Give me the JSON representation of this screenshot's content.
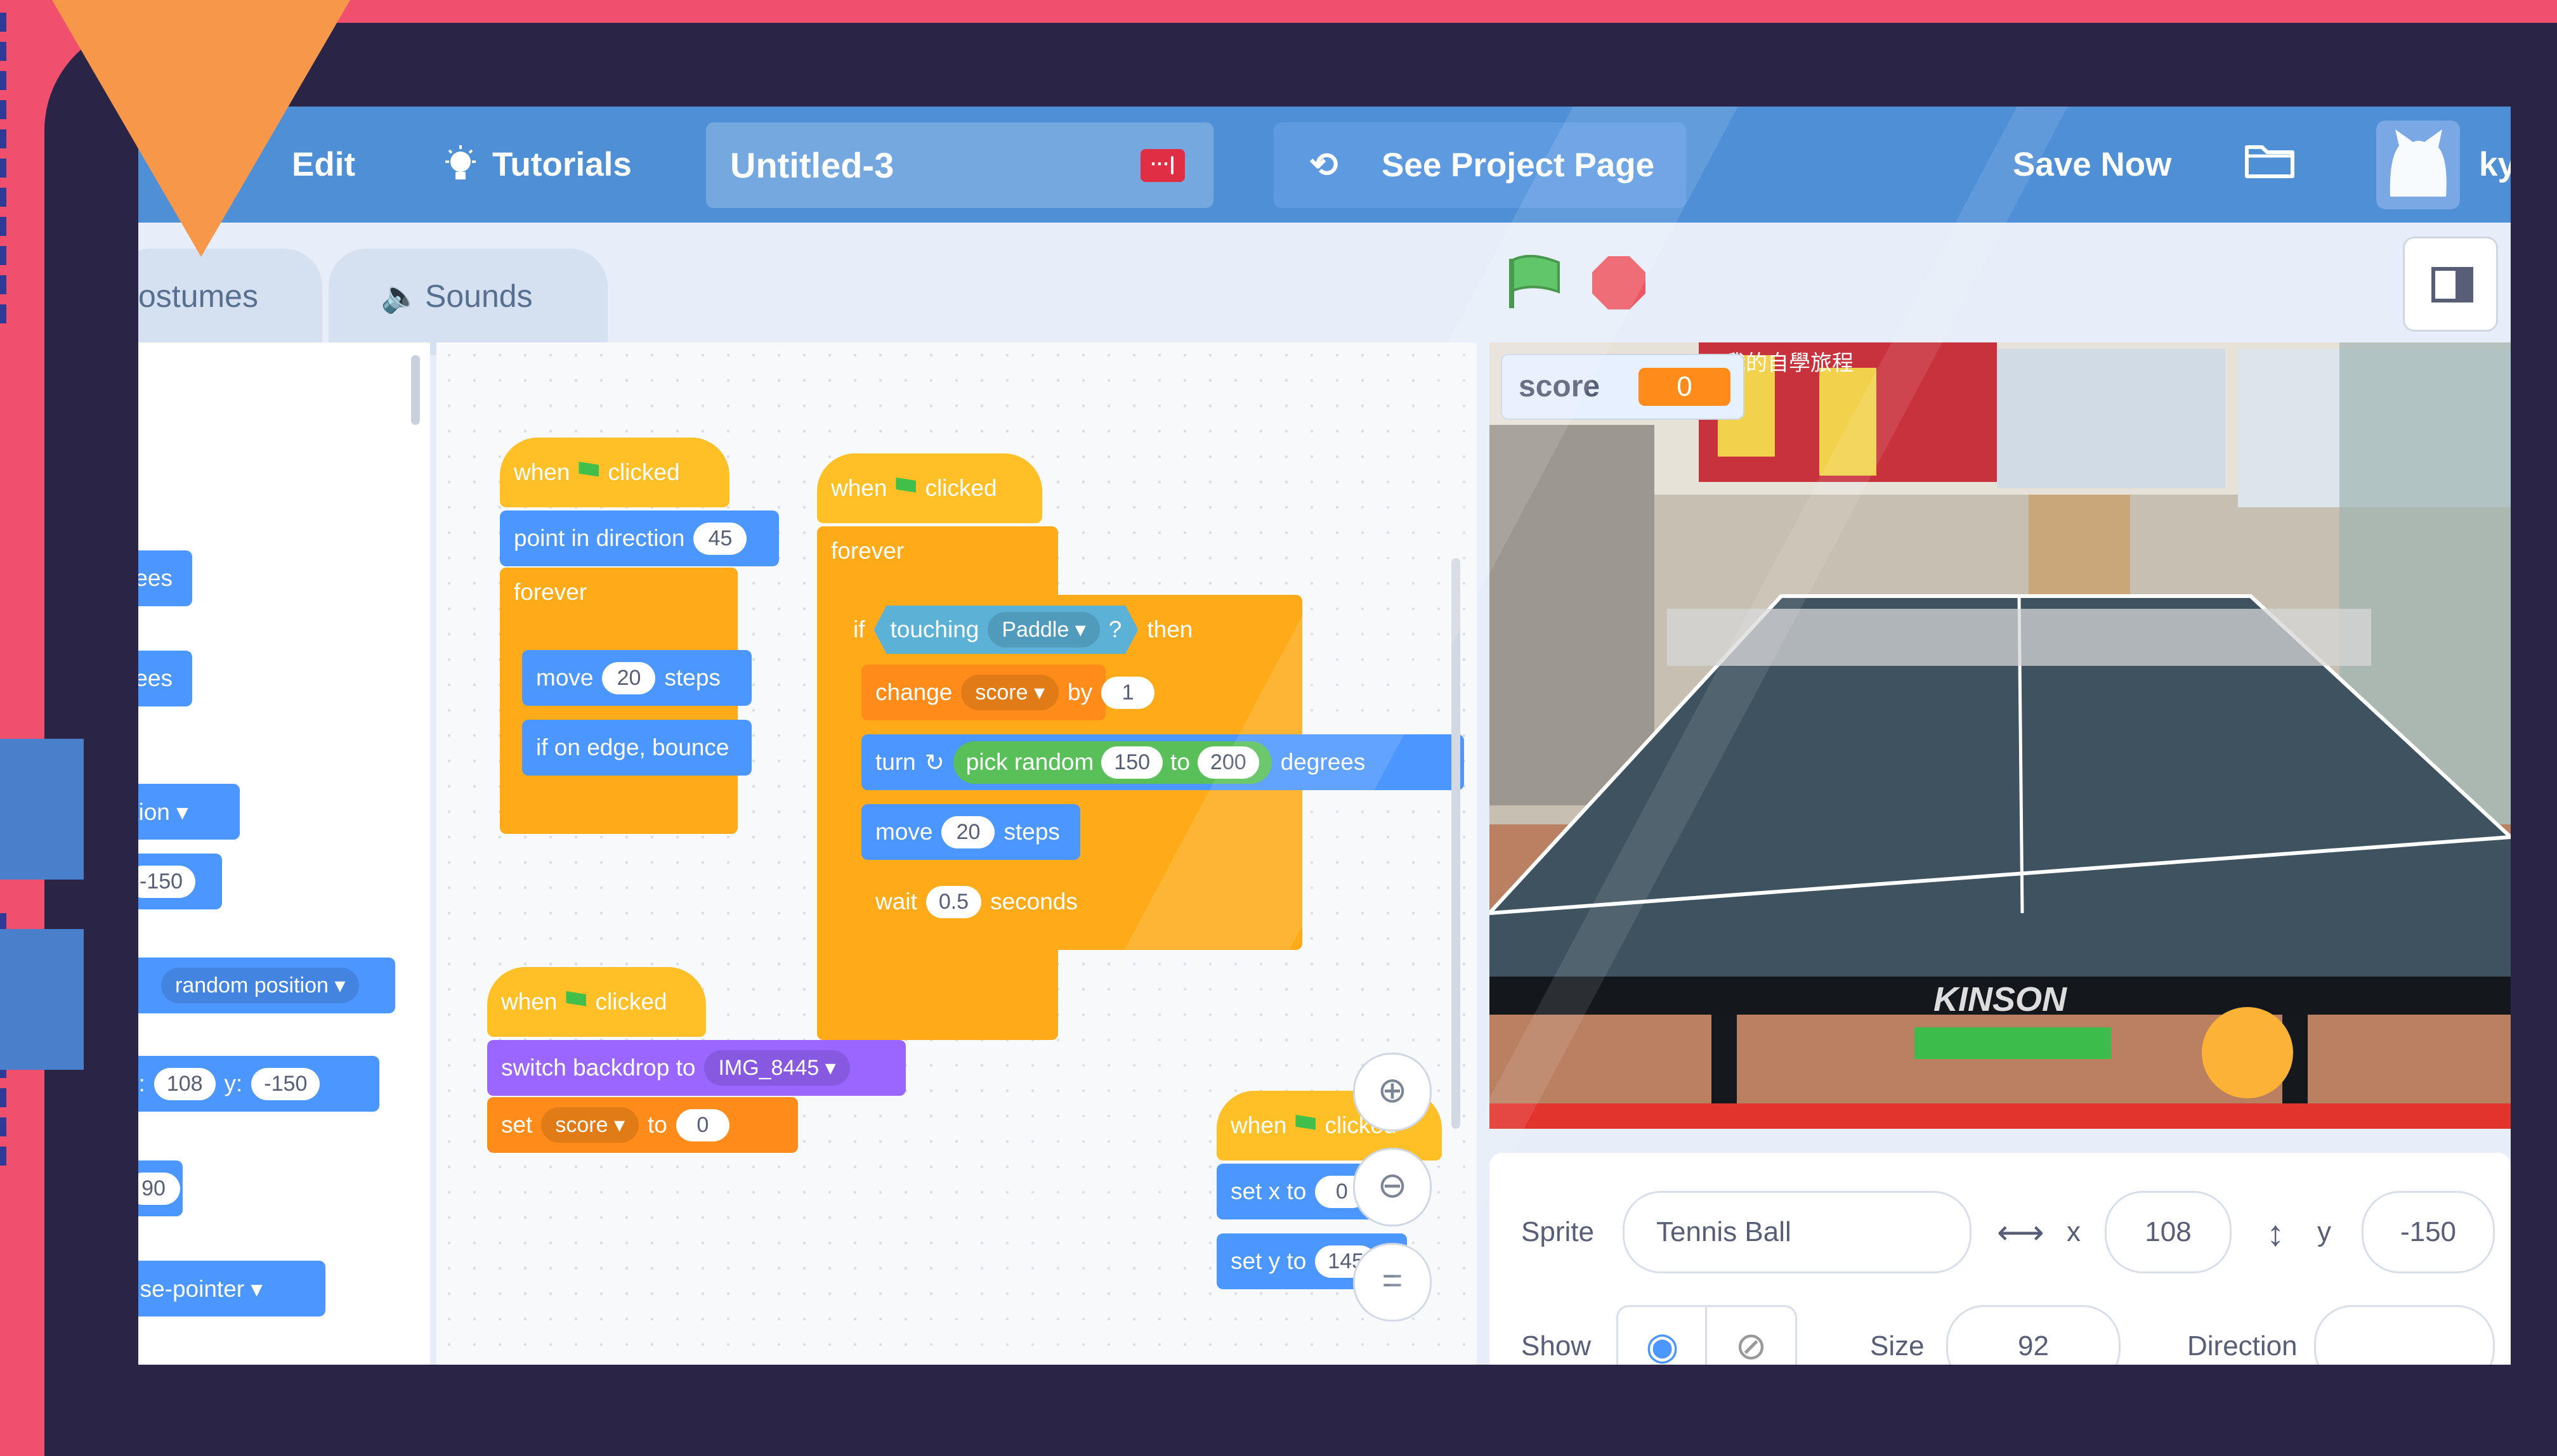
{
  "menubar": {
    "edit": "Edit",
    "tutorials": "Tutorials",
    "project_title": "Untitled-3",
    "see_project_page": "See Project Page",
    "save_now": "Save Now",
    "user_partial": "ky"
  },
  "tabs": {
    "costumes": "ostumes",
    "sounds": "Sounds"
  },
  "palette": [
    {
      "text": "rees"
    },
    {
      "text": "rees"
    },
    {
      "text": "ition ▾"
    },
    {
      "text": "-150"
    },
    {
      "text": "random position ▾"
    },
    {
      "x_label": "x:",
      "x": "108",
      "y_label": "y:",
      "y": "-150"
    },
    {
      "text": "90"
    },
    {
      "text": "use-pointer ▾"
    }
  ],
  "scripts": {
    "s1": {
      "when": "when",
      "clicked": "clicked",
      "point": "point in direction",
      "dir": "45",
      "forever": "forever",
      "move": "move",
      "steps_val": "20",
      "steps": "steps",
      "bounce": "if on edge, bounce"
    },
    "s2": {
      "when": "when",
      "clicked": "clicked",
      "forever": "forever",
      "if": "if",
      "touching": "touching",
      "paddle": "Paddle ▾",
      "q": "?",
      "then": "then",
      "change": "change",
      "score_var": "score ▾",
      "by": "by",
      "by_val": "1",
      "turn": "turn",
      "pick": "pick random",
      "from": "150",
      "to": "to",
      "to_val": "200",
      "degrees": "degrees",
      "move": "move",
      "move_val": "20",
      "steps": "steps",
      "wait": "wait",
      "wait_val": "0.5",
      "seconds": "seconds"
    },
    "s3": {
      "when": "when",
      "clicked": "clicked",
      "switch": "switch backdrop to",
      "backdrop": "IMG_8445 ▾",
      "set": "set",
      "score_var": "score ▾",
      "to": "to",
      "to_val": "0"
    },
    "s4": {
      "when": "when",
      "clicked": "clicked",
      "setx": "set x to",
      "x_val": "0",
      "sety": "set y to",
      "y_val": "145"
    }
  },
  "stage": {
    "score_label": "score",
    "score_value": "0",
    "table_brand": "KINSON",
    "banner_text": "我的自學旅程"
  },
  "sprite": {
    "sprite_label": "Sprite",
    "name": "Tennis Ball",
    "x_label": "x",
    "x": "108",
    "y_label": "y",
    "y": "-150",
    "show_label": "Show",
    "size_label": "Size",
    "size": "92",
    "direction_label": "Direction"
  },
  "colors": {
    "accent": "#4e8fd6",
    "events": "#ffbf26",
    "control": "#ffab19",
    "motion": "#4c97ff",
    "looks": "#9966ff",
    "sensing": "#5cb1d6",
    "variables": "#ff8c1a",
    "backdrop_pink": "#f0506e",
    "frame": "#2a2446"
  }
}
